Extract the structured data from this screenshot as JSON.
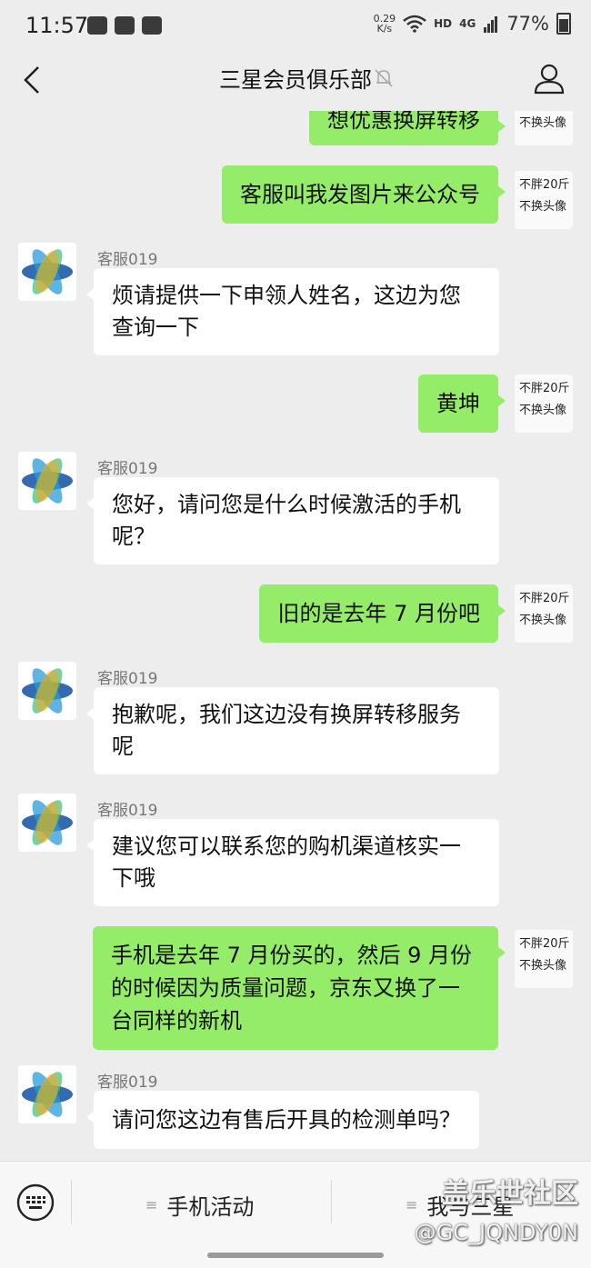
{
  "status_bar": {
    "time": "11:57",
    "net_speed": "0.29",
    "net_speed_unit": "K/s",
    "hd": "HD",
    "signal": "4G",
    "battery": "77%"
  },
  "header": {
    "title": "三星会员俱乐部"
  },
  "avatar_caption": {
    "line1": "不胖20斤",
    "line2": "不换头像"
  },
  "messages": [
    {
      "side": "right",
      "text": "想优惠换屏转移"
    },
    {
      "side": "right",
      "text": "客服叫我发图片来公众号"
    },
    {
      "side": "left",
      "sender": "客服019",
      "text": "烦请提供一下申领人姓名，这边为您查询一下"
    },
    {
      "side": "right",
      "text": "黄坤"
    },
    {
      "side": "left",
      "sender": "客服019",
      "text": "您好，请问您是什么时候激活的手机呢？"
    },
    {
      "side": "right",
      "text": "旧的是去年 7 月份吧"
    },
    {
      "side": "left",
      "sender": "客服019",
      "text": "抱歉呢，我们这边没有换屏转移服务呢"
    },
    {
      "side": "left",
      "sender": "客服019",
      "text": "建议您可以联系您的购机渠道核实一下哦"
    },
    {
      "side": "right",
      "text": "手机是去年 7 月份买的，然后 9 月份的时候因为质量问题，京东又换了一台同样的新机"
    },
    {
      "side": "left",
      "sender": "客服019",
      "text": "请问您这边有售后开具的检测单吗？"
    }
  ],
  "bottom_menu": {
    "item1": "手机活动",
    "item2": "我与三星"
  },
  "watermark": {
    "line1": "盖乐世社区",
    "line2": "@GC_JQNDY0N"
  }
}
